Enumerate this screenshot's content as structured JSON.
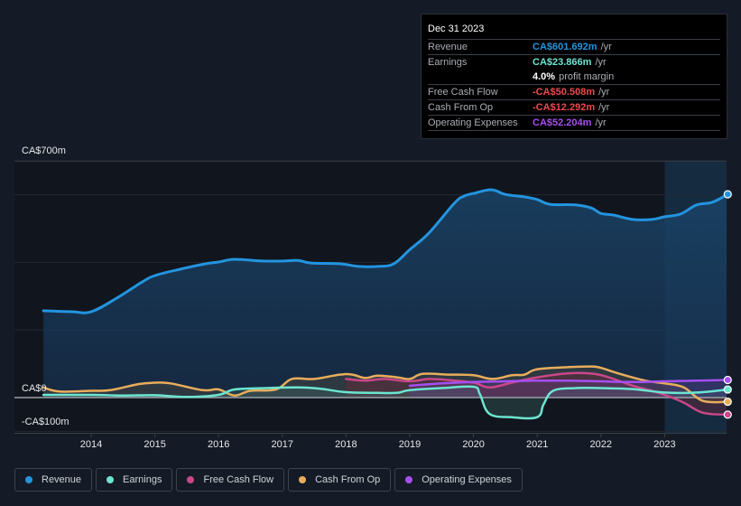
{
  "tooltip": {
    "date": "Dec 31 2023",
    "rows": [
      {
        "label": "Revenue",
        "value": "CA$601.692m",
        "unit": "/yr",
        "color": "#2394df"
      },
      {
        "label": "Earnings",
        "value": "CA$23.866m",
        "unit": "/yr",
        "color": "#6ce5d1"
      },
      {
        "label": "",
        "value": "4.0%",
        "unit": "profit margin",
        "color": "#ffffff"
      },
      {
        "label": "Free Cash Flow",
        "value": "-CA$50.508m",
        "unit": "/yr",
        "color": "#ea4b4f"
      },
      {
        "label": "Cash From Op",
        "value": "-CA$12.292m",
        "unit": "/yr",
        "color": "#ea4b4f"
      },
      {
        "label": "Operating Expenses",
        "value": "CA$52.204m",
        "unit": "/yr",
        "color": "#a64ff0"
      }
    ]
  },
  "legend": [
    {
      "label": "Revenue",
      "color": "#2394df"
    },
    {
      "label": "Earnings",
      "color": "#6ce5d1"
    },
    {
      "label": "Free Cash Flow",
      "color": "#c9478a"
    },
    {
      "label": "Cash From Op",
      "color": "#e8ad5c"
    },
    {
      "label": "Operating Expenses",
      "color": "#a64ff0"
    }
  ],
  "chart_data": {
    "type": "line",
    "title": "",
    "xlabel": "",
    "ylabel": "",
    "y_axis_labels": [
      "CA$700m",
      "CA$0",
      "-CA$100m"
    ],
    "ylim": [
      -100,
      700
    ],
    "xlim": [
      2013.25,
      2023.99
    ],
    "x_ticks": [
      "2014",
      "2015",
      "2016",
      "2017",
      "2018",
      "2019",
      "2020",
      "2021",
      "2022",
      "2023"
    ],
    "highlight_from": 2023.0,
    "grid": true,
    "legend_position": "bottom",
    "unit": "CA$ millions",
    "series": [
      {
        "name": "Revenue",
        "color": "#2394df",
        "fill": true,
        "x": [
          2013.25,
          2013.7,
          2014.0,
          2014.4,
          2014.8,
          2015.0,
          2015.4,
          2015.8,
          2016.0,
          2016.25,
          2016.7,
          2017.0,
          2017.25,
          2017.45,
          2017.9,
          2018.2,
          2018.5,
          2018.75,
          2019.0,
          2019.3,
          2019.7,
          2019.85,
          2020.0,
          2020.28,
          2020.5,
          2020.8,
          2021.0,
          2021.2,
          2021.6,
          2021.85,
          2022.0,
          2022.2,
          2022.5,
          2022.8,
          2023.0,
          2023.25,
          2023.5,
          2023.75,
          2023.99
        ],
        "values": [
          257,
          254,
          254,
          294,
          342,
          361,
          380,
          396,
          401,
          409,
          404,
          404,
          406,
          398,
          396,
          388,
          388,
          396,
          438,
          487,
          575,
          596,
          604,
          615,
          601,
          594,
          586,
          572,
          570,
          561,
          545,
          540,
          527,
          527,
          535,
          543,
          570,
          578,
          601.692
        ]
      },
      {
        "name": "Earnings",
        "color": "#6ce5d1",
        "fill": true,
        "x": [
          2013.25,
          2014.0,
          2014.5,
          2015.0,
          2015.5,
          2016.0,
          2016.25,
          2016.75,
          2017.25,
          2017.6,
          2018.0,
          2018.5,
          2018.8,
          2019.0,
          2019.5,
          2020.0,
          2020.1,
          2020.25,
          2020.6,
          2021.0,
          2021.1,
          2021.25,
          2021.6,
          2022.0,
          2022.5,
          2023.0,
          2023.5,
          2023.99
        ],
        "values": [
          8,
          8,
          6,
          7,
          2,
          8,
          24,
          28,
          30,
          26,
          16,
          14,
          14,
          22,
          28,
          32,
          10,
          -48,
          -58,
          -58,
          -20,
          20,
          28,
          28,
          25,
          15,
          15,
          23.866
        ]
      },
      {
        "name": "Free Cash Flow",
        "color": "#c9478a",
        "fill": true,
        "x": [
          2018.0,
          2018.3,
          2018.6,
          2019.0,
          2019.3,
          2019.6,
          2020.0,
          2020.25,
          2020.6,
          2021.0,
          2021.5,
          2021.9,
          2022.2,
          2022.5,
          2022.8,
          2023.0,
          2023.3,
          2023.6,
          2023.99
        ],
        "values": [
          55,
          50,
          55,
          48,
          55,
          52,
          44,
          30,
          44,
          60,
          72,
          70,
          55,
          35,
          20,
          8,
          -15,
          -45,
          -50.508
        ]
      },
      {
        "name": "Cash From Op",
        "color": "#e8ad5c",
        "fill": true,
        "x": [
          2013.25,
          2013.5,
          2014.0,
          2014.3,
          2014.75,
          2015.0,
          2015.25,
          2015.75,
          2016.0,
          2016.25,
          2016.5,
          2016.9,
          2017.15,
          2017.5,
          2017.9,
          2018.1,
          2018.3,
          2018.5,
          2018.8,
          2019.0,
          2019.2,
          2019.6,
          2020.0,
          2020.3,
          2020.6,
          2020.8,
          2021.0,
          2021.5,
          2021.85,
          2022.0,
          2022.3,
          2022.7,
          2023.0,
          2023.3,
          2023.6,
          2023.99
        ],
        "values": [
          30,
          18,
          20,
          22,
          40,
          44,
          42,
          22,
          24,
          6,
          20,
          24,
          55,
          55,
          68,
          68,
          58,
          65,
          60,
          55,
          70,
          68,
          66,
          55,
          66,
          68,
          84,
          90,
          92,
          88,
          70,
          50,
          42,
          30,
          -10,
          -12.292
        ]
      },
      {
        "name": "Operating Expenses",
        "color": "#a64ff0",
        "fill": true,
        "x": [
          2019.0,
          2019.5,
          2020.0,
          2020.5,
          2021.0,
          2021.5,
          2022.0,
          2022.5,
          2023.0,
          2023.5,
          2023.99
        ],
        "values": [
          35,
          42,
          46,
          48,
          50,
          50,
          48,
          46,
          48,
          50,
          52.204
        ]
      }
    ]
  }
}
